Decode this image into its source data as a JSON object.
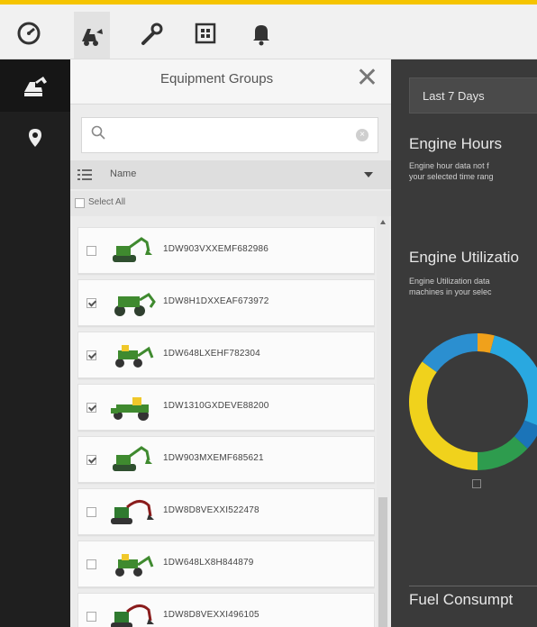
{
  "nav": {
    "tabs": [
      {
        "icon": "speedometer-icon",
        "active": false
      },
      {
        "icon": "equipment-icon",
        "active": true
      },
      {
        "icon": "wrench-icon",
        "active": false
      },
      {
        "icon": "grid-icon",
        "active": false
      },
      {
        "icon": "bell-icon",
        "active": false
      }
    ],
    "accent": "#f5c400"
  },
  "rail": {
    "items": [
      {
        "icon": "machine-icon",
        "active": true
      },
      {
        "icon": "location-pin-icon",
        "active": false
      }
    ]
  },
  "panel": {
    "title": "Equipment Groups",
    "close": "✕",
    "search_placeholder": "",
    "sort_label": "Name",
    "select_all": "Select All",
    "items": [
      {
        "id": "1DW903VXXEMF682986",
        "checked": false,
        "machine": "excavator-green"
      },
      {
        "id": "1DW8H1DXXEAF673972",
        "checked": true,
        "machine": "loader-green"
      },
      {
        "id": "1DW648LXEHF782304",
        "checked": true,
        "machine": "loader-yellow"
      },
      {
        "id": "1DW1310GXDEVE88200",
        "checked": true,
        "machine": "tractor-green"
      },
      {
        "id": "1DW903MXEMF685621",
        "checked": true,
        "machine": "excavator-green"
      },
      {
        "id": "1DW8D8VEXXI522478",
        "checked": false,
        "machine": "excavator-large"
      },
      {
        "id": "1DW648LX8H844879",
        "checked": false,
        "machine": "loader-yellow"
      },
      {
        "id": "1DW8D8VEXXI496105",
        "checked": false,
        "machine": "excavator-large"
      }
    ]
  },
  "dashboard": {
    "range": "Last 7 Days",
    "engine_hours": {
      "title": "Engine Hours",
      "desc_line1": "Engine hour data not f",
      "desc_line2": "your selected time rang"
    },
    "engine_utilization": {
      "title": "Engine Utilizatio",
      "desc_line1": "Engine Utilization data",
      "desc_line2": "machines in your selec"
    },
    "donut": {
      "colors": [
        "#f0a11b",
        "#29a8e0",
        "#1b74b8",
        "#2e9c4e",
        "#f0d21c",
        "#2b8fd0"
      ],
      "shares": [
        0.04,
        0.27,
        0.06,
        0.13,
        0.35,
        0.15
      ]
    },
    "fuel": {
      "title": "Fuel Consumpt"
    }
  }
}
